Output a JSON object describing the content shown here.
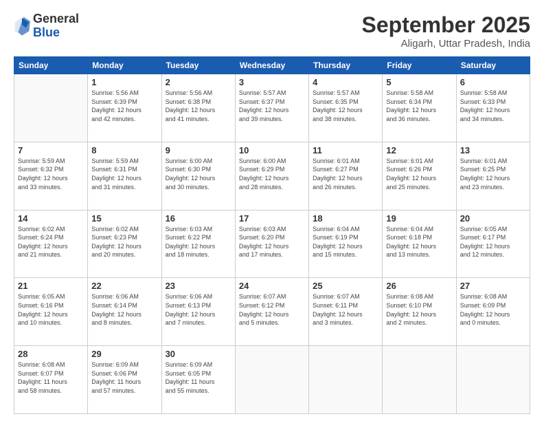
{
  "logo": {
    "general": "General",
    "blue": "Blue"
  },
  "header": {
    "month": "September 2025",
    "location": "Aligarh, Uttar Pradesh, India"
  },
  "weekdays": [
    "Sunday",
    "Monday",
    "Tuesday",
    "Wednesday",
    "Thursday",
    "Friday",
    "Saturday"
  ],
  "weeks": [
    [
      {
        "day": "",
        "info": ""
      },
      {
        "day": "1",
        "info": "Sunrise: 5:56 AM\nSunset: 6:39 PM\nDaylight: 12 hours\nand 42 minutes."
      },
      {
        "day": "2",
        "info": "Sunrise: 5:56 AM\nSunset: 6:38 PM\nDaylight: 12 hours\nand 41 minutes."
      },
      {
        "day": "3",
        "info": "Sunrise: 5:57 AM\nSunset: 6:37 PM\nDaylight: 12 hours\nand 39 minutes."
      },
      {
        "day": "4",
        "info": "Sunrise: 5:57 AM\nSunset: 6:35 PM\nDaylight: 12 hours\nand 38 minutes."
      },
      {
        "day": "5",
        "info": "Sunrise: 5:58 AM\nSunset: 6:34 PM\nDaylight: 12 hours\nand 36 minutes."
      },
      {
        "day": "6",
        "info": "Sunrise: 5:58 AM\nSunset: 6:33 PM\nDaylight: 12 hours\nand 34 minutes."
      }
    ],
    [
      {
        "day": "7",
        "info": "Sunrise: 5:59 AM\nSunset: 6:32 PM\nDaylight: 12 hours\nand 33 minutes."
      },
      {
        "day": "8",
        "info": "Sunrise: 5:59 AM\nSunset: 6:31 PM\nDaylight: 12 hours\nand 31 minutes."
      },
      {
        "day": "9",
        "info": "Sunrise: 6:00 AM\nSunset: 6:30 PM\nDaylight: 12 hours\nand 30 minutes."
      },
      {
        "day": "10",
        "info": "Sunrise: 6:00 AM\nSunset: 6:29 PM\nDaylight: 12 hours\nand 28 minutes."
      },
      {
        "day": "11",
        "info": "Sunrise: 6:01 AM\nSunset: 6:27 PM\nDaylight: 12 hours\nand 26 minutes."
      },
      {
        "day": "12",
        "info": "Sunrise: 6:01 AM\nSunset: 6:26 PM\nDaylight: 12 hours\nand 25 minutes."
      },
      {
        "day": "13",
        "info": "Sunrise: 6:01 AM\nSunset: 6:25 PM\nDaylight: 12 hours\nand 23 minutes."
      }
    ],
    [
      {
        "day": "14",
        "info": "Sunrise: 6:02 AM\nSunset: 6:24 PM\nDaylight: 12 hours\nand 21 minutes."
      },
      {
        "day": "15",
        "info": "Sunrise: 6:02 AM\nSunset: 6:23 PM\nDaylight: 12 hours\nand 20 minutes."
      },
      {
        "day": "16",
        "info": "Sunrise: 6:03 AM\nSunset: 6:22 PM\nDaylight: 12 hours\nand 18 minutes."
      },
      {
        "day": "17",
        "info": "Sunrise: 6:03 AM\nSunset: 6:20 PM\nDaylight: 12 hours\nand 17 minutes."
      },
      {
        "day": "18",
        "info": "Sunrise: 6:04 AM\nSunset: 6:19 PM\nDaylight: 12 hours\nand 15 minutes."
      },
      {
        "day": "19",
        "info": "Sunrise: 6:04 AM\nSunset: 6:18 PM\nDaylight: 12 hours\nand 13 minutes."
      },
      {
        "day": "20",
        "info": "Sunrise: 6:05 AM\nSunset: 6:17 PM\nDaylight: 12 hours\nand 12 minutes."
      }
    ],
    [
      {
        "day": "21",
        "info": "Sunrise: 6:05 AM\nSunset: 6:16 PM\nDaylight: 12 hours\nand 10 minutes."
      },
      {
        "day": "22",
        "info": "Sunrise: 6:06 AM\nSunset: 6:14 PM\nDaylight: 12 hours\nand 8 minutes."
      },
      {
        "day": "23",
        "info": "Sunrise: 6:06 AM\nSunset: 6:13 PM\nDaylight: 12 hours\nand 7 minutes."
      },
      {
        "day": "24",
        "info": "Sunrise: 6:07 AM\nSunset: 6:12 PM\nDaylight: 12 hours\nand 5 minutes."
      },
      {
        "day": "25",
        "info": "Sunrise: 6:07 AM\nSunset: 6:11 PM\nDaylight: 12 hours\nand 3 minutes."
      },
      {
        "day": "26",
        "info": "Sunrise: 6:08 AM\nSunset: 6:10 PM\nDaylight: 12 hours\nand 2 minutes."
      },
      {
        "day": "27",
        "info": "Sunrise: 6:08 AM\nSunset: 6:09 PM\nDaylight: 12 hours\nand 0 minutes."
      }
    ],
    [
      {
        "day": "28",
        "info": "Sunrise: 6:08 AM\nSunset: 6:07 PM\nDaylight: 11 hours\nand 58 minutes."
      },
      {
        "day": "29",
        "info": "Sunrise: 6:09 AM\nSunset: 6:06 PM\nDaylight: 11 hours\nand 57 minutes."
      },
      {
        "day": "30",
        "info": "Sunrise: 6:09 AM\nSunset: 6:05 PM\nDaylight: 11 hours\nand 55 minutes."
      },
      {
        "day": "",
        "info": ""
      },
      {
        "day": "",
        "info": ""
      },
      {
        "day": "",
        "info": ""
      },
      {
        "day": "",
        "info": ""
      }
    ]
  ]
}
